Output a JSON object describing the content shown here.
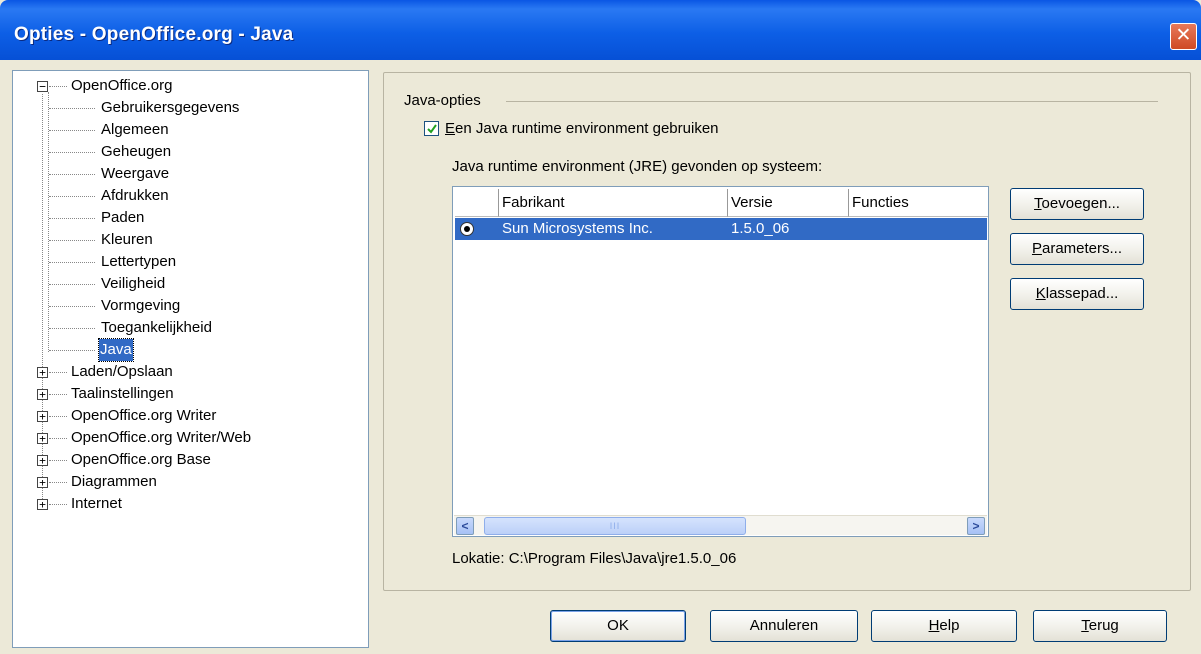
{
  "window": {
    "title": "Opties - OpenOffice.org - Java",
    "close_glyph": "✕"
  },
  "tree": {
    "root": {
      "toggle": "−",
      "label": "OpenOffice.org"
    },
    "children": [
      "Gebruikersgegevens",
      "Algemeen",
      "Geheugen",
      "Weergave",
      "Afdrukken",
      "Paden",
      "Kleuren",
      "Lettertypen",
      "Veiligheid",
      "Vormgeving",
      "Toegankelijkheid",
      "Java"
    ],
    "selected": "Java",
    "collapsed": [
      "Laden/Opslaan",
      "Taalinstellingen",
      "OpenOffice.org Writer",
      "OpenOffice.org Writer/Web",
      "OpenOffice.org Base",
      "Diagrammen",
      "Internet"
    ],
    "collapsed_toggle": "+"
  },
  "java_options": {
    "group_label": "Java-opties",
    "use_jre": {
      "checked": true,
      "label_first": "E",
      "label_rest": "en Java runtime environment gebruiken"
    },
    "jre_found_label": "Java runtime environment (JRE) gevonden op systeem:",
    "table": {
      "headers": [
        "Fabrikant",
        "Versie",
        "Functies"
      ],
      "rows": [
        {
          "selected": true,
          "vendor": "Sun Microsystems Inc.",
          "version": "1.5.0_06",
          "features": ""
        }
      ],
      "scroll_left": "<",
      "scroll_right": ">",
      "thumb_grip": "III"
    },
    "location": "Lokatie: C:\\Program Files\\Java\\jre1.5.0_06"
  },
  "side_buttons": [
    {
      "accel": "T",
      "rest": "oevoegen..."
    },
    {
      "accel": "P",
      "rest": "arameters..."
    },
    {
      "accel": "K",
      "rest": "lassepad..."
    }
  ],
  "footer_buttons": {
    "ok": "OK",
    "cancel": "Annuleren",
    "help": {
      "accel": "H",
      "rest": "elp"
    },
    "back": {
      "accel": "T",
      "rest": "erug"
    }
  },
  "colors": {
    "titlebar": "#0a56e4",
    "selection": "#316ac5",
    "panel_bg": "#ece9d8"
  }
}
